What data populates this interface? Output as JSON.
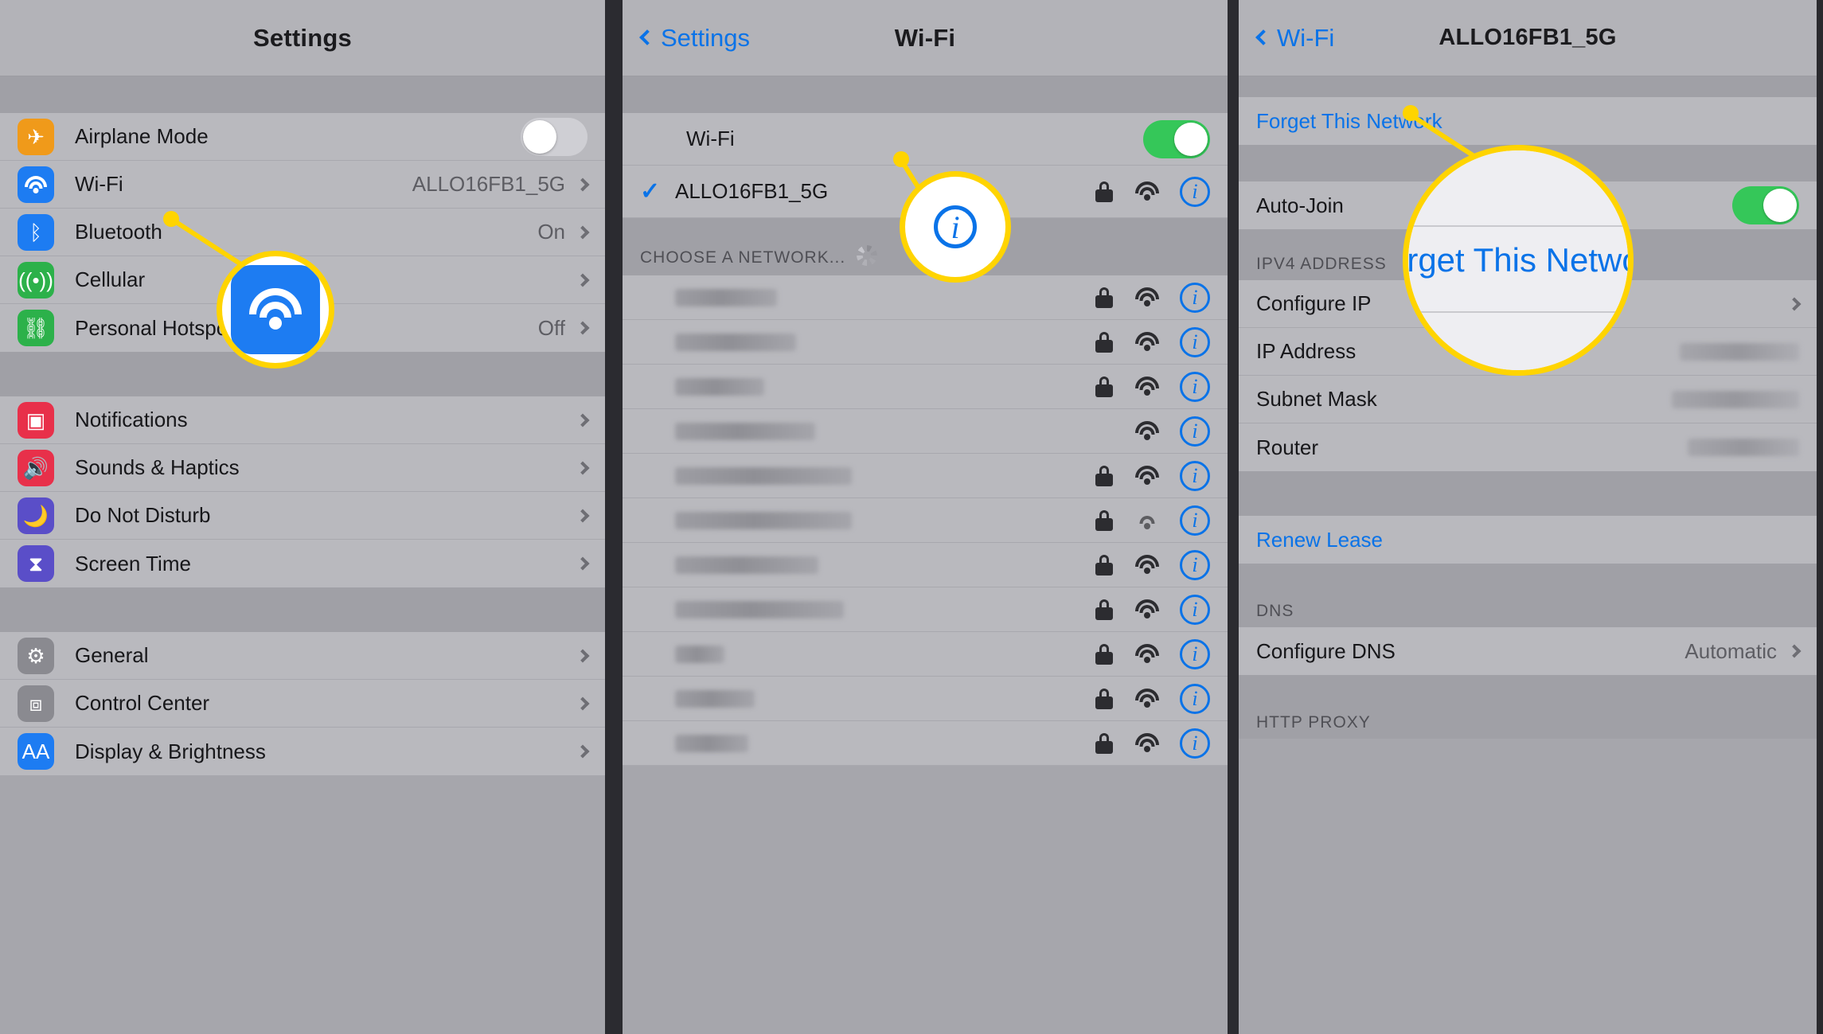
{
  "panel1": {
    "title": "Settings",
    "groups": [
      {
        "rows": [
          {
            "label": "Airplane Mode",
            "icon": "airplane-icon",
            "icon_color": "#f09a1a",
            "control": "toggle-off"
          },
          {
            "label": "Wi-Fi",
            "icon": "wifi-icon",
            "icon_color": "#1d7cf2",
            "value": "ALLO16FB1_5G",
            "control": "chevron"
          },
          {
            "label": "Bluetooth",
            "icon": "bluetooth-icon",
            "icon_color": "#1d7cf2",
            "value": "On",
            "control": "chevron"
          },
          {
            "label": "Cellular",
            "icon": "cellular-icon",
            "icon_color": "#2cb14a",
            "value": "",
            "control": "chevron"
          },
          {
            "label": "Personal Hotspot",
            "icon": "hotspot-icon",
            "icon_color": "#2cb14a",
            "value": "Off",
            "control": "chevron"
          }
        ]
      },
      {
        "rows": [
          {
            "label": "Notifications",
            "icon": "notifications-icon",
            "icon_color": "#e8304a",
            "value": "",
            "control": "chevron"
          },
          {
            "label": "Sounds & Haptics",
            "icon": "sounds-icon",
            "icon_color": "#e8304a",
            "value": "",
            "control": "chevron"
          },
          {
            "label": "Do Not Disturb",
            "icon": "moon-icon",
            "icon_color": "#5a4ec8",
            "value": "",
            "control": "chevron"
          },
          {
            "label": "Screen Time",
            "icon": "hourglass-icon",
            "icon_color": "#5a4ec8",
            "value": "",
            "control": "chevron"
          }
        ]
      },
      {
        "rows": [
          {
            "label": "General",
            "icon": "gear-icon",
            "icon_color": "#8a8a90",
            "value": "",
            "control": "chevron"
          },
          {
            "label": "Control Center",
            "icon": "control-center-icon",
            "icon_color": "#8a8a90",
            "value": "",
            "control": "chevron"
          },
          {
            "label": "Display & Brightness",
            "icon": "display-icon",
            "icon_color": "#1d7cf2",
            "value": "",
            "control": "chevron"
          }
        ]
      }
    ]
  },
  "panel2": {
    "back_label": "Settings",
    "title": "Wi-Fi",
    "wifi_row_label": "Wi-Fi",
    "wifi_enabled": true,
    "connected_ssid": "ALLO16FB1_5G",
    "section_header": "CHOOSE A NETWORK...",
    "networks": [
      {
        "name_width": 128,
        "locked": true,
        "strength": 3
      },
      {
        "name_width": 152,
        "locked": true,
        "strength": 3
      },
      {
        "name_width": 112,
        "locked": true,
        "strength": 3
      },
      {
        "name_width": 176,
        "locked": false,
        "strength": 3
      },
      {
        "name_width": 222,
        "locked": true,
        "strength": 3
      },
      {
        "name_width": 222,
        "locked": true,
        "strength": 2
      },
      {
        "name_width": 180,
        "locked": true,
        "strength": 3
      },
      {
        "name_width": 212,
        "locked": true,
        "strength": 3
      },
      {
        "name_width": 62,
        "locked": true,
        "strength": 3
      },
      {
        "name_width": 100,
        "locked": true,
        "strength": 3
      },
      {
        "name_width": 92,
        "locked": true,
        "strength": 3
      }
    ]
  },
  "panel3": {
    "back_label": "Wi-Fi",
    "title": "ALLO16FB1_5G",
    "forget_label": "Forget This Network",
    "auto_join_label": "Auto-Join",
    "auto_join_on": true,
    "ipv4_header": "IPV4 ADDRESS",
    "ipv4_rows": [
      {
        "label": "Configure IP",
        "value": "",
        "control": "chevron",
        "blur_width": 0
      },
      {
        "label": "IP Address",
        "value": "",
        "control": "blur",
        "blur_width": 150
      },
      {
        "label": "Subnet Mask",
        "value": "",
        "control": "blur",
        "blur_width": 160
      },
      {
        "label": "Router",
        "value": "",
        "control": "blur",
        "blur_width": 140
      }
    ],
    "renew_lease_label": "Renew Lease",
    "dns_header": "DNS",
    "dns_row": {
      "label": "Configure DNS",
      "value": "Automatic"
    },
    "http_proxy_header": "HTTP PROXY"
  },
  "callouts": {
    "wifi_icon_name": "wifi-app-icon",
    "info_icon_name": "info-icon",
    "forget_text": "Forget This Network"
  },
  "colors": {
    "accent_blue": "#0a73e8",
    "highlight_yellow": "#ffd400",
    "toggle_green": "#35c759"
  }
}
